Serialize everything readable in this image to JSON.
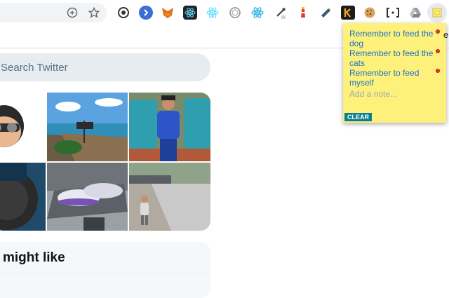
{
  "search": {
    "placeholder": "Search Twitter"
  },
  "card": {
    "title": "might like"
  },
  "note": {
    "items": [
      {
        "text": "Remember to feed the dog"
      },
      {
        "text": "Remember to feed the cats"
      },
      {
        "text": "Remember to feed myself"
      }
    ],
    "placeholder": "Add a note...",
    "clear_label": "CLEAR"
  },
  "toolbar": {
    "edge_text": "e"
  }
}
